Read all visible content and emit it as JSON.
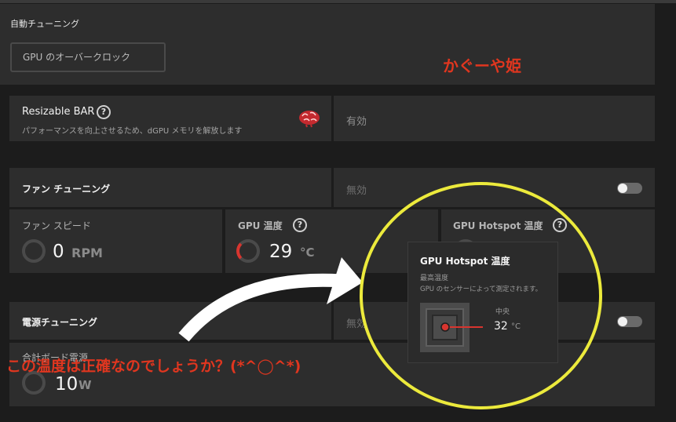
{
  "auto_tuning": {
    "label": "自動チューニング",
    "field_value": "GPU のオーバークロック"
  },
  "annotation_name": "かぐーや姫",
  "resizable_bar": {
    "title": "Resizable BAR",
    "help": "?",
    "description": "パフォーマンスを向上させるため、dGPU メモリを解放します",
    "status": "有効"
  },
  "fan_tuning": {
    "title": "ファン チューニング",
    "status": "無効",
    "toggle_on": false
  },
  "metrics": {
    "fan_speed": {
      "label": "ファン スピード",
      "value": "0",
      "unit": "RPM"
    },
    "gpu_temp": {
      "label": "GPU 温度",
      "help": "?",
      "value": "29",
      "unit": "°C"
    },
    "gpu_hotspot": {
      "label": "GPU Hotspot 温度",
      "help": "?"
    }
  },
  "tooltip": {
    "title": "GPU Hotspot 温度",
    "line1": "最高温度",
    "line2": "GPU のセンサーによって測定されます。",
    "location_label": "中央",
    "value": "32",
    "unit": "°C"
  },
  "power_tuning": {
    "title": "電源チューニング",
    "status": "無効",
    "toggle_on": false
  },
  "power_metric": {
    "label": "合計ボード電源",
    "value": "10",
    "unit": "W"
  },
  "annotation_question": "この温度は正確なのでしょうか？(*^◯^*)",
  "colors": {
    "card": "#2d2d2d",
    "background": "#1c1c1c",
    "annotation_red": "#e0361f",
    "circle_yellow": "#ecea3c",
    "gauge_red": "#d8352f"
  }
}
